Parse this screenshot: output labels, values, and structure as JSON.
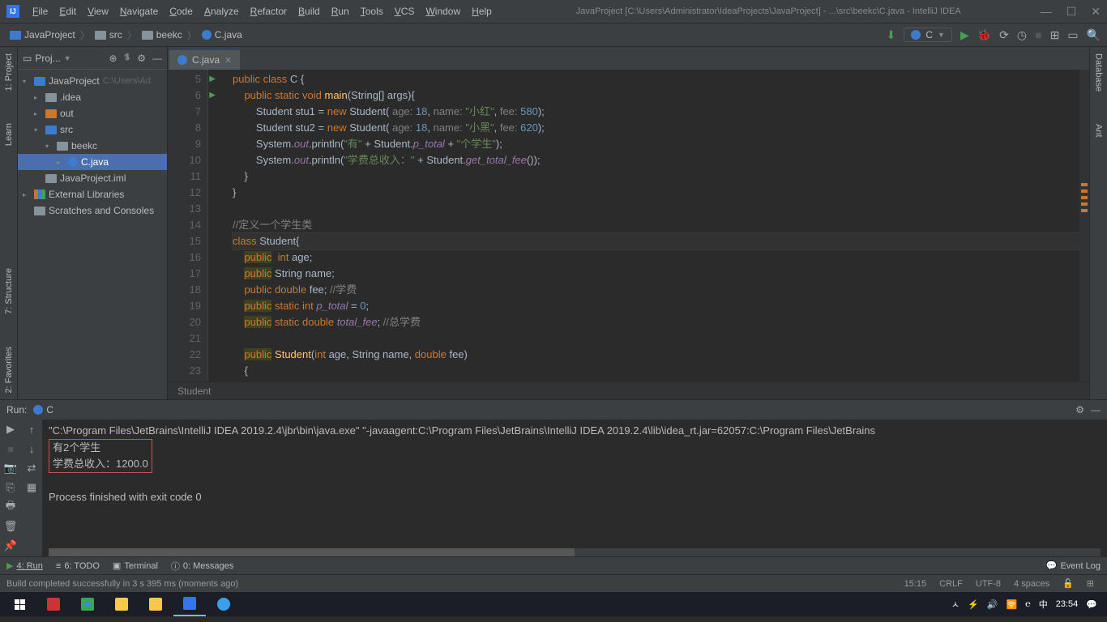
{
  "title": "JavaProject [C:\\Users\\Administrator\\IdeaProjects\\JavaProject] - ...\\src\\beekc\\C.java - IntelliJ IDEA",
  "menu": [
    "File",
    "Edit",
    "View",
    "Navigate",
    "Code",
    "Analyze",
    "Refactor",
    "Build",
    "Run",
    "Tools",
    "VCS",
    "Window",
    "Help"
  ],
  "breadcrumb": [
    "JavaProject",
    "src",
    "beekc",
    "C.java"
  ],
  "runConfig": "C",
  "projectPane": {
    "title": "Proj...",
    "tree": [
      {
        "indent": 0,
        "arrow": "▾",
        "icon": "mod",
        "label": "JavaProject",
        "dim": "C:\\Users\\Ad"
      },
      {
        "indent": 1,
        "arrow": "▸",
        "icon": "dir",
        "label": ".idea"
      },
      {
        "indent": 1,
        "arrow": "▸",
        "icon": "dirout",
        "label": "out"
      },
      {
        "indent": 1,
        "arrow": "▾",
        "icon": "dirsrc",
        "label": "src"
      },
      {
        "indent": 2,
        "arrow": "▾",
        "icon": "pkg",
        "label": "beekc"
      },
      {
        "indent": 3,
        "arrow": "▸",
        "icon": "java",
        "label": "C.java",
        "sel": true
      },
      {
        "indent": 1,
        "arrow": "",
        "icon": "dir",
        "label": "JavaProject.iml"
      },
      {
        "indent": 0,
        "arrow": "▸",
        "icon": "lib",
        "label": "External Libraries"
      },
      {
        "indent": 0,
        "arrow": "",
        "icon": "dir",
        "label": "Scratches and Consoles"
      }
    ]
  },
  "editor": {
    "tab": "C.java",
    "crumb": "Student",
    "firstLine": 5,
    "currentLine": 15,
    "runMarkers": [
      5,
      6
    ],
    "tokenLines": [
      [
        {
          "t": "public",
          "c": "kw"
        },
        {
          "t": " "
        },
        {
          "t": "class",
          "c": "kw"
        },
        {
          "t": " C {"
        }
      ],
      [
        {
          "t": "    "
        },
        {
          "t": "public",
          "c": "kw"
        },
        {
          "t": " "
        },
        {
          "t": "static",
          "c": "kw"
        },
        {
          "t": " "
        },
        {
          "t": "void",
          "c": "kw"
        },
        {
          "t": " "
        },
        {
          "t": "main",
          "c": "fn"
        },
        {
          "t": "(String[] args){"
        }
      ],
      [
        {
          "t": "        Student "
        },
        {
          "t": "stu1"
        },
        {
          "t": " = "
        },
        {
          "t": "new",
          "c": "kw"
        },
        {
          "t": " Student( "
        },
        {
          "t": "age: ",
          "c": "param"
        },
        {
          "t": "18",
          "c": "num"
        },
        {
          "t": ", "
        },
        {
          "t": "name: ",
          "c": "param"
        },
        {
          "t": "\"小红\"",
          "c": "str"
        },
        {
          "t": ", "
        },
        {
          "t": "fee: ",
          "c": "param"
        },
        {
          "t": "580",
          "c": "num"
        },
        {
          "t": ");"
        }
      ],
      [
        {
          "t": "        Student "
        },
        {
          "t": "stu2"
        },
        {
          "t": " = "
        },
        {
          "t": "new",
          "c": "kw"
        },
        {
          "t": " Student( "
        },
        {
          "t": "age: ",
          "c": "param"
        },
        {
          "t": "18",
          "c": "num"
        },
        {
          "t": ", "
        },
        {
          "t": "name: ",
          "c": "param"
        },
        {
          "t": "\"小黑\"",
          "c": "str"
        },
        {
          "t": ", "
        },
        {
          "t": "fee: ",
          "c": "param"
        },
        {
          "t": "620",
          "c": "num"
        },
        {
          "t": ");"
        }
      ],
      [
        {
          "t": "        System."
        },
        {
          "t": "out",
          "c": "fld"
        },
        {
          "t": ".println("
        },
        {
          "t": "\"有\"",
          "c": "str"
        },
        {
          "t": " + Student."
        },
        {
          "t": "p_total",
          "c": "fld"
        },
        {
          "t": " + "
        },
        {
          "t": "\"个学生\"",
          "c": "str"
        },
        {
          "t": ");"
        }
      ],
      [
        {
          "t": "        System."
        },
        {
          "t": "out",
          "c": "fld"
        },
        {
          "t": ".println("
        },
        {
          "t": "\"学费总收入：\"",
          "c": "str"
        },
        {
          "t": " + Student."
        },
        {
          "t": "get_total_fee",
          "c": "fld"
        },
        {
          "t": "());"
        }
      ],
      [
        {
          "t": "    }"
        }
      ],
      [
        {
          "t": "}"
        }
      ],
      [],
      [
        {
          "t": "//定义一个学生类",
          "c": "com"
        }
      ],
      [
        {
          "t": "class",
          "c": "kw"
        },
        {
          "t": " Student{"
        }
      ],
      [
        {
          "t": "    "
        },
        {
          "t": "public",
          "c": "hlkw"
        },
        {
          "t": "  "
        },
        {
          "t": "int",
          "c": "kw"
        },
        {
          "t": " age;"
        }
      ],
      [
        {
          "t": "    "
        },
        {
          "t": "public",
          "c": "hlkw"
        },
        {
          "t": " String name;"
        }
      ],
      [
        {
          "t": "    "
        },
        {
          "t": "public",
          "c": "kw"
        },
        {
          "t": " "
        },
        {
          "t": "double",
          "c": "kw"
        },
        {
          "t": " fee; "
        },
        {
          "t": "//学费",
          "c": "com"
        }
      ],
      [
        {
          "t": "    "
        },
        {
          "t": "public",
          "c": "hlkw"
        },
        {
          "t": " "
        },
        {
          "t": "static",
          "c": "kw"
        },
        {
          "t": " "
        },
        {
          "t": "int",
          "c": "kw"
        },
        {
          "t": " "
        },
        {
          "t": "p_total",
          "c": "fld"
        },
        {
          "t": " = "
        },
        {
          "t": "0",
          "c": "num"
        },
        {
          "t": ";"
        }
      ],
      [
        {
          "t": "    "
        },
        {
          "t": "public",
          "c": "hlkw"
        },
        {
          "t": " "
        },
        {
          "t": "static",
          "c": "kw"
        },
        {
          "t": " "
        },
        {
          "t": "double",
          "c": "kw"
        },
        {
          "t": " "
        },
        {
          "t": "total_fee",
          "c": "fld"
        },
        {
          "t": "; "
        },
        {
          "t": "//总学费",
          "c": "com"
        }
      ],
      [],
      [
        {
          "t": "    "
        },
        {
          "t": "public",
          "c": "hlkw"
        },
        {
          "t": " "
        },
        {
          "t": "Student",
          "c": "fn"
        },
        {
          "t": "("
        },
        {
          "t": "int",
          "c": "kw"
        },
        {
          "t": " age, String name, "
        },
        {
          "t": "double",
          "c": "kw"
        },
        {
          "t": " fee)"
        }
      ],
      [
        {
          "t": "    {"
        }
      ]
    ]
  },
  "leftTabs": [
    "1: Project",
    "Learn"
  ],
  "leftBottomTabs": [
    "2: Favorites",
    "7: Structure"
  ],
  "rightTabs": [
    "Database",
    "Ant"
  ],
  "run": {
    "title": "Run:",
    "cfg": "C",
    "cmd": "\"C:\\Program Files\\JetBrains\\IntelliJ IDEA 2019.2.4\\jbr\\bin\\java.exe\" \"-javaagent:C:\\Program Files\\JetBrains\\IntelliJ IDEA 2019.2.4\\lib\\idea_rt.jar=62057:C:\\Program Files\\JetBrains",
    "out1": "有2个学生",
    "out2": "学费总收入：1200.0",
    "exit": "Process finished with exit code 0"
  },
  "bottomTabs": {
    "run": "4: Run",
    "todo": "6: TODO",
    "terminal": "Terminal",
    "messages": "0: Messages",
    "eventlog": "Event Log"
  },
  "status": {
    "msg": "Build completed successfully in 3 s 395 ms (moments ago)",
    "pos": "15:15",
    "eol": "CRLF",
    "enc": "UTF-8",
    "indent": "4 spaces",
    "lock": "🔓"
  },
  "taskbar": {
    "clock": "23:54",
    "ime": "中"
  }
}
